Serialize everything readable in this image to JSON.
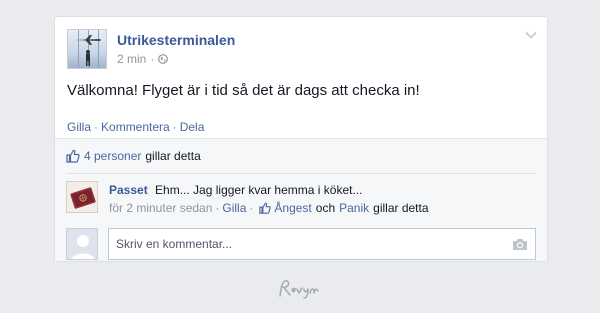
{
  "post": {
    "page_name": "Utrikesterminalen",
    "time": "2 min",
    "meta_dot": "·",
    "text": "Välkomna! Flyget är i tid så det är dags att checka in!",
    "icons": {
      "avatar": "airport-terminal-avatar-icon",
      "audience": "globe-icon",
      "menu": "chevron-down-icon"
    }
  },
  "actions": {
    "like": "Gilla",
    "sep": "·",
    "comment": "Kommentera",
    "share": "Dela"
  },
  "likes": {
    "icon": "thumbs-up-icon",
    "count_label": "4 personer",
    "suffix": "gillar detta"
  },
  "comment": {
    "author": "Passet",
    "text": "Ehm... Jag ligger kvar hemma i köket...",
    "time": "för 2 minuter sedan",
    "sep": "·",
    "like": "Gilla",
    "reactor1": "Ångest",
    "conj": "och",
    "reactor2": "Panik",
    "suffix": "gillar detta",
    "icons": {
      "avatar": "passport-avatar-icon",
      "like": "thumbs-up-icon"
    }
  },
  "composer": {
    "placeholder": "Skriv en kommentar...",
    "icons": {
      "avatar": "default-user-avatar-icon",
      "camera": "camera-icon"
    }
  },
  "footer": {
    "icon": "signature-logo-icon"
  },
  "colors": {
    "background": "#e9ebee",
    "card": "#ffffff",
    "link": "#4b67a1",
    "name": "#3b5998",
    "muted": "#90949c",
    "ufi_bg": "#f6f7f9"
  }
}
